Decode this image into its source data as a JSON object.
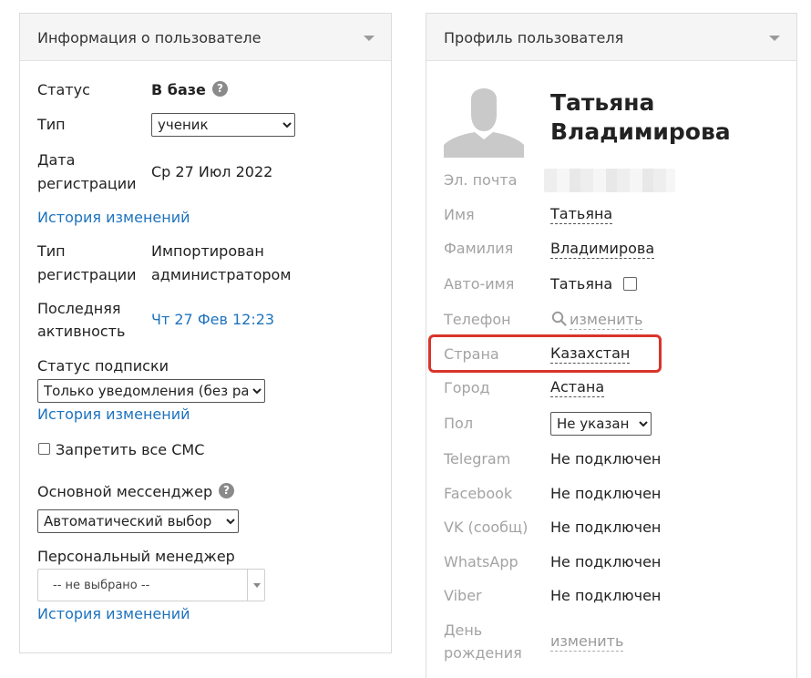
{
  "left_panel": {
    "title": "Информация о пользователе",
    "status_label": "Статус",
    "status_value": "В базе",
    "type_label": "Тип",
    "type_selected": "ученик",
    "reg_date_label": [
      "Дата",
      "регистрации"
    ],
    "reg_date_value": "Ср 27 Июл 2022",
    "history_link_1": "История изменений",
    "reg_type_label": [
      "Тип",
      "регистрации"
    ],
    "reg_type_value": [
      "Импортирован",
      "администратором"
    ],
    "last_activity_label": [
      "Последняя",
      "активность"
    ],
    "last_activity_value": "Чт 27 Фев 12:23",
    "subscription_label": "Статус подписки",
    "subscription_selected": "Только уведомления (без рассылок)",
    "history_link_2": "История изменений",
    "block_sms_label": "Запретить все СМС",
    "messenger_label": "Основной мессенджер",
    "messenger_selected": "Автоматический выбор",
    "manager_label": "Персональный менеджер",
    "manager_selected": "-- не выбрано --",
    "history_link_3": "История изменений"
  },
  "right_panel": {
    "title": "Профиль пользователя",
    "name_line1": "Татьяна",
    "name_line2": "Владимирова",
    "email_label": "Эл. почта",
    "first_name_label": "Имя",
    "first_name_value": "Татьяна",
    "last_name_label": "Фамилия",
    "last_name_value": "Владимирова",
    "auto_name_label": "Авто-имя",
    "auto_name_value": "Татьяна",
    "phone_label": "Телефон",
    "phone_action": "изменить",
    "country_label": "Страна",
    "country_value": "Казахстан",
    "city_label": "Город",
    "city_value": "Астана",
    "gender_label": "Пол",
    "gender_selected": "Не указан",
    "telegram_label": "Telegram",
    "telegram_value": "Не подключен",
    "facebook_label": "Facebook",
    "facebook_value": "Не подключен",
    "vk_label": "VK (сообщ)",
    "vk_value": "Не подключен",
    "whatsapp_label": "WhatsApp",
    "whatsapp_value": "Не подключен",
    "viber_label": "Viber",
    "viber_value": "Не подключен",
    "birthday_label": [
      "День",
      "рождения"
    ],
    "birthday_action": "изменить"
  },
  "colors": {
    "link": "#1e73be",
    "highlight": "#d9342b",
    "muted_label": "#a3a3a3"
  },
  "icons": {
    "help": "help-circle-icon",
    "collapse": "chevron-down-icon",
    "phone_search": "search-icon",
    "avatar": "user-silhouette-icon"
  }
}
